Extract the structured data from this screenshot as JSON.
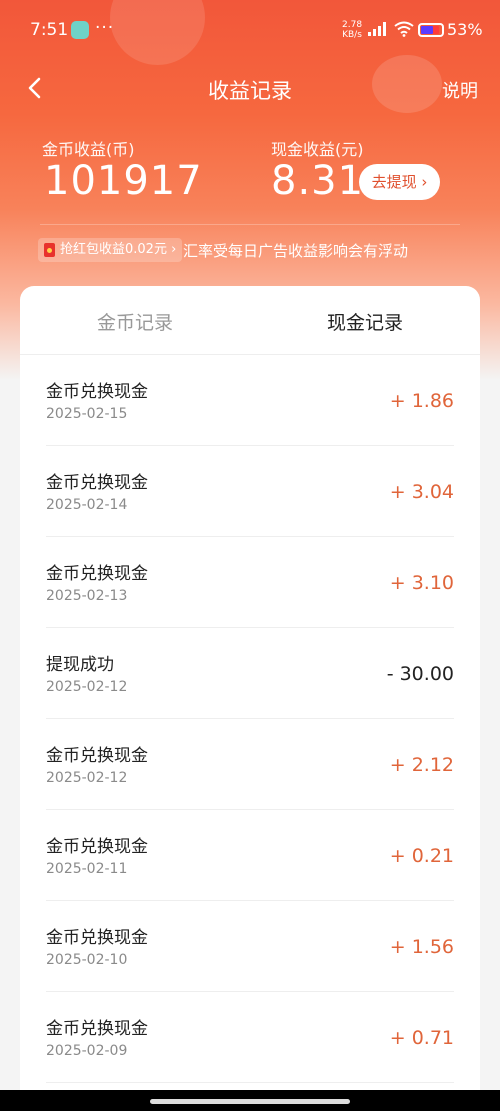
{
  "status_bar": {
    "time": "7:51",
    "more": "···",
    "net_speed_value": "2.78",
    "net_speed_unit": "KB/s",
    "battery_pct": "53%"
  },
  "nav": {
    "title": "收益记录",
    "help_label": "说明"
  },
  "summary": {
    "coin_label": "金币收益(币)",
    "coin_value": "101917",
    "cash_label": "现金收益(元)",
    "cash_value": "8.31",
    "withdraw_label": "去提现 ›",
    "redpack_tag": "抢红包收益0.02元 ›",
    "rate_note": "汇率受每日广告收益影响会有浮动"
  },
  "tabs": {
    "coin": "金币记录",
    "cash": "现金记录"
  },
  "records": [
    {
      "title": "金币兑换现金",
      "date": "2025-02-15",
      "amount": "+ 1.86",
      "sign": "pos"
    },
    {
      "title": "金币兑换现金",
      "date": "2025-02-14",
      "amount": "+ 3.04",
      "sign": "pos"
    },
    {
      "title": "金币兑换现金",
      "date": "2025-02-13",
      "amount": "+ 3.10",
      "sign": "pos"
    },
    {
      "title": "提现成功",
      "date": "2025-02-12",
      "amount": "- 30.00",
      "sign": "neg"
    },
    {
      "title": "金币兑换现金",
      "date": "2025-02-12",
      "amount": "+ 2.12",
      "sign": "pos"
    },
    {
      "title": "金币兑换现金",
      "date": "2025-02-11",
      "amount": "+ 0.21",
      "sign": "pos"
    },
    {
      "title": "金币兑换现金",
      "date": "2025-02-10",
      "amount": "+ 1.56",
      "sign": "pos"
    },
    {
      "title": "金币兑换现金",
      "date": "2025-02-09",
      "amount": "+ 0.71",
      "sign": "pos"
    }
  ],
  "colors": {
    "accent": "#f2573a",
    "positive_amount": "#e0653a"
  }
}
